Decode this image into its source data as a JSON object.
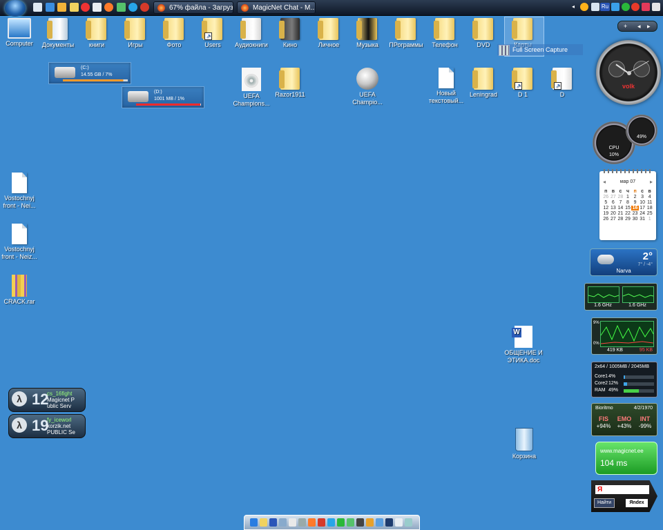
{
  "taskbar": {
    "tasks": [
      {
        "label": "67% файла - Загруз..."
      },
      {
        "label": "MagicNet Chat - M..."
      }
    ],
    "quicklaunch_icons": [
      "monitor-icon",
      "ie-icon",
      "media-player-icon",
      "folder-icon",
      "gmail-icon",
      "messenger-icon",
      "firefox-icon",
      "network-icon",
      "skype-icon",
      "opera-icon"
    ],
    "tray_icons": [
      "arrow-icon",
      "search-icon",
      "window-icon",
      "ru-language-icon",
      "network-icon",
      "security-icon",
      "update-icon",
      "shield-icon",
      "volume-icon"
    ]
  },
  "desktop": {
    "icons": [
      {
        "label": "Computer",
        "type": "computer"
      },
      {
        "label": "Документы",
        "type": "documents"
      },
      {
        "label": "книги",
        "type": "folder"
      },
      {
        "label": "Игры",
        "type": "folder"
      },
      {
        "label": "Фото",
        "type": "folder"
      },
      {
        "label": "Users",
        "type": "folder-shortcut"
      },
      {
        "label": "Аудиокниги",
        "type": "folder"
      },
      {
        "label": "Кино",
        "type": "folder"
      },
      {
        "label": "Личное",
        "type": "folder"
      },
      {
        "label": "Музыка",
        "type": "folder"
      },
      {
        "label": "ПРограммы",
        "type": "folder"
      },
      {
        "label": "Телефон",
        "type": "folder"
      },
      {
        "label": "DVD",
        "type": "folder"
      },
      {
        "label": "Карты",
        "type": "folder"
      },
      {
        "label": "UEFA Champions...",
        "type": "disc"
      },
      {
        "label": "Razor1911",
        "type": "folder"
      },
      {
        "label": "UEFA Champio...",
        "type": "ball"
      },
      {
        "label": "Новый текстовый...",
        "type": "document"
      },
      {
        "label": "Leningrad",
        "type": "folder"
      },
      {
        "label": "D 1",
        "type": "folder-shortcut"
      },
      {
        "label": "D",
        "type": "folder-shortcut"
      },
      {
        "label": "Vostochnyj front - Nei...",
        "type": "document"
      },
      {
        "label": "Vostochnyj front - Neiz...",
        "type": "document"
      },
      {
        "label": "CRACK.rar",
        "type": "rar"
      },
      {
        "label": "ОБЩЕНИЕ И ЭТИКА.doc",
        "type": "word"
      },
      {
        "label": "Корзина",
        "type": "recycle-bin"
      }
    ]
  },
  "drives": [
    {
      "name": "(C:)",
      "info": "14.55 GB / 7%",
      "bar_color": "#ff9a2a",
      "used_fraction": 0.93
    },
    {
      "name": "(D:)",
      "info": "1001 MB / 1%",
      "bar_color": "#ff2a2a",
      "used_fraction": 0.99
    }
  ],
  "capture": {
    "label": "Full Screen Capture"
  },
  "game_servers": [
    {
      "logo": "λ",
      "players": "12",
      "map": "cs_16fight",
      "line1": "Magicnet P",
      "line2": "ublic Serv"
    },
    {
      "logo": "λ",
      "players": "19",
      "map": "fy_iceworl",
      "line1": "korzik.net",
      "line2": "PUBLIC Se"
    }
  ],
  "clock": {
    "logo": "volk",
    "hour": 10,
    "minute": 10
  },
  "meters": {
    "cpu_label": "CPU",
    "cpu_value": "10%",
    "mem_value": "49%"
  },
  "calendar": {
    "month": "мар 07",
    "weekdays": [
      "п",
      "в",
      "с",
      "ч",
      "п",
      "с",
      "в"
    ],
    "days": [
      [
        "26",
        "27",
        "28",
        "1",
        "2",
        "3",
        "4"
      ],
      [
        "5",
        "6",
        "7",
        "8",
        "9",
        "10",
        "11"
      ],
      [
        "12",
        "13",
        "14",
        "15",
        "16",
        "17",
        "18"
      ],
      [
        "19",
        "20",
        "21",
        "22",
        "23",
        "24",
        "25"
      ],
      [
        "26",
        "27",
        "28",
        "29",
        "30",
        "31",
        "1"
      ]
    ],
    "today": "16"
  },
  "weather": {
    "city": "Narva",
    "temp": "2°",
    "range": "7° / -4°"
  },
  "cpu_meter": {
    "core1_freq": "1.6 GHz",
    "core2_freq": "1.6 GHz"
  },
  "network": {
    "max": "9%",
    "min": "0%",
    "down": "419 KB",
    "up": "95 KB"
  },
  "system": {
    "header": "2x64 / 1005MB / 2045MB",
    "rows": [
      {
        "name": "Core1",
        "value": "4%",
        "fraction": 0.04
      },
      {
        "name": "Core2",
        "value": "12%",
        "fraction": 0.12
      },
      {
        "name": "RAM",
        "value": "49%",
        "fraction": 0.49
      }
    ]
  },
  "biorhythm": {
    "title": "Bioritmo",
    "date": "4/2/1970",
    "cols": [
      {
        "key": "FIS",
        "value": "+94%"
      },
      {
        "key": "EMO",
        "value": "+43%"
      },
      {
        "key": "INT",
        "value": "-99%"
      }
    ]
  },
  "ping": {
    "site": "www.magicnet.ee",
    "value": "104 ms"
  },
  "search": {
    "ya": "Я",
    "button": "Найти",
    "logo": "Яndex"
  },
  "sidebar_ctrl": {
    "add": "+",
    "prev": "◂",
    "next": "▸"
  },
  "dock": {
    "icons": [
      "windows-icon",
      "folder-icon",
      "word-icon",
      "explorer-icon",
      "cs-icon",
      "gear-icon",
      "firefox-icon",
      "opera-icon",
      "skype-icon",
      "qip-icon",
      "torrent-icon",
      "media-icon",
      "winamp-icon",
      "chat-icon",
      "photoshop-icon",
      "mail-icon",
      "recycle-icon"
    ]
  }
}
